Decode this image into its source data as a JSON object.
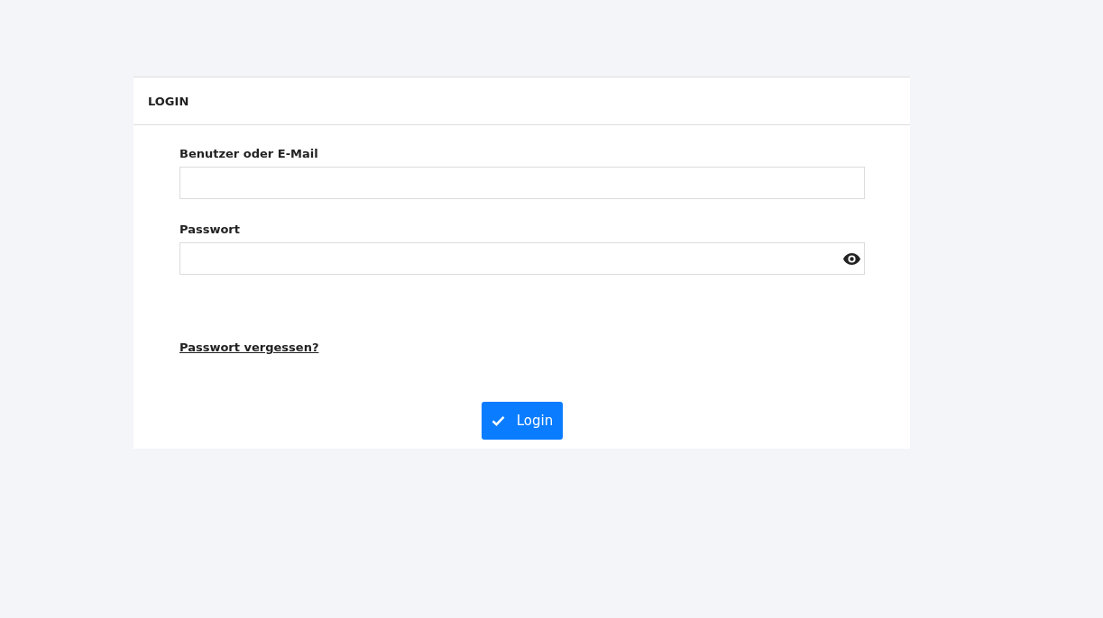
{
  "card": {
    "title": "LOGIN"
  },
  "fields": [
    {
      "label": "Benutzer oder E-Mail",
      "kind": "text"
    },
    {
      "label": "Passwort",
      "kind": "password"
    }
  ],
  "forgot_link": "Passwort vergessen?",
  "submit_button": "Login"
}
